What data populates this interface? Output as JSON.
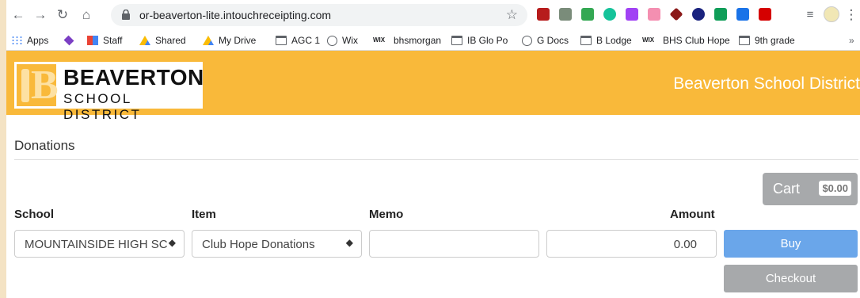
{
  "browser": {
    "url": "or-beaverton-lite.intouchreceipting.com",
    "bookmarks": [
      "Apps",
      "Staff",
      "Shared",
      "My Drive",
      "AGC 1",
      "Wix",
      "bhsmorgan",
      "IB Glo Po",
      "G Docs",
      "B Lodge",
      "BHS Club Hope",
      "9th grade"
    ],
    "overflow": "»"
  },
  "header": {
    "logo_name": "BEAVERTON",
    "logo_sub": "SCHOOL DISTRICT",
    "district_title": "Beaverton School District"
  },
  "page": {
    "title": "Donations"
  },
  "cart": {
    "label": "Cart",
    "total": "$0.00"
  },
  "form": {
    "school_label": "School",
    "school_value": "MOUNTAINSIDE HIGH SC",
    "item_label": "Item",
    "item_value": "Club Hope Donations",
    "memo_label": "Memo",
    "memo_value": "",
    "amount_label": "Amount",
    "amount_value": "0.00",
    "buy_label": "Buy",
    "checkout_label": "Checkout"
  },
  "colors": {
    "brand": "#f9b93a",
    "buy": "#6aa6ea",
    "disabled": "#a7a9ab"
  }
}
